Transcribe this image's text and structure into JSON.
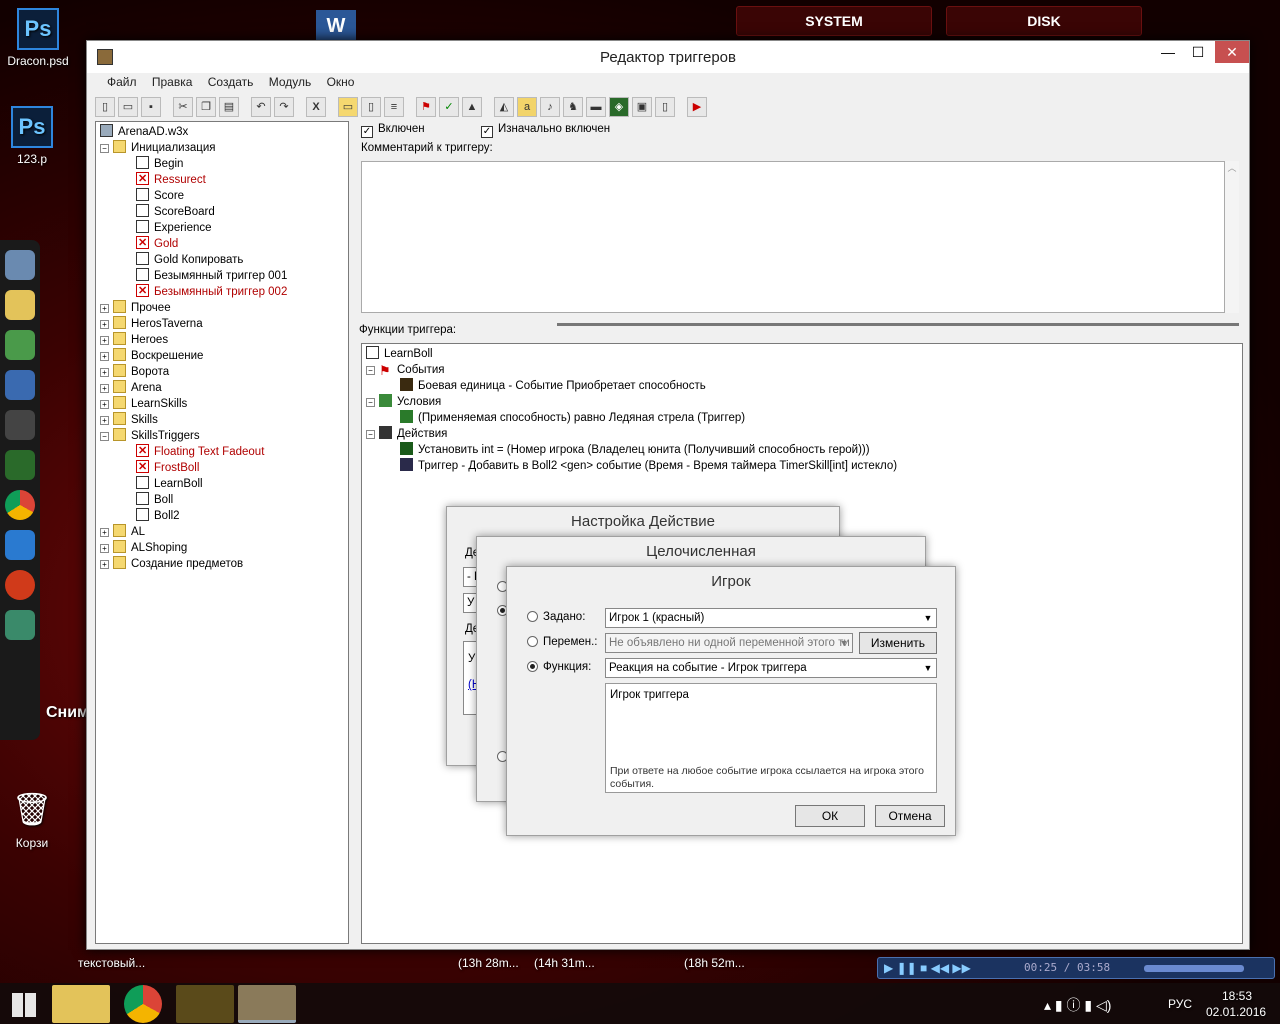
{
  "desktop": {
    "icons": [
      {
        "label": "Dracon.psd",
        "glyph": "Ps"
      },
      {
        "label": "123.p",
        "glyph": "Ps"
      },
      {
        "label": "Корзи",
        "glyph": "🗑"
      }
    ],
    "top_buttons": [
      "SYSTEM",
      "DISK"
    ],
    "screenshot_label": "Снимок экрана",
    "word_icon": "W"
  },
  "window": {
    "title": "Редактор триггеров",
    "controls": {
      "minimize": "—",
      "maximize": "☐",
      "close": "✕"
    },
    "menu": [
      "Файл",
      "Правка",
      "Создать",
      "Модуль",
      "Окно"
    ]
  },
  "tree": {
    "root": "ArenaAD.w3x",
    "nodes": [
      {
        "label": "Инициализация",
        "kind": "folder",
        "expander": "−"
      },
      {
        "label": "Begin",
        "kind": "doc"
      },
      {
        "label": "Ressurect",
        "kind": "disabled"
      },
      {
        "label": "Score",
        "kind": "doc"
      },
      {
        "label": "ScoreBoard",
        "kind": "doc"
      },
      {
        "label": "Experience",
        "kind": "doc"
      },
      {
        "label": "Gold",
        "kind": "disabled"
      },
      {
        "label": "Gold Копировать",
        "kind": "doc"
      },
      {
        "label": "Безымянный триггер 001",
        "kind": "doc"
      },
      {
        "label": "Безымянный триггер 002",
        "kind": "disabled"
      },
      {
        "label": "Прочее",
        "kind": "folder",
        "expander": "+"
      },
      {
        "label": "HerosTaverna",
        "kind": "folder",
        "expander": "+"
      },
      {
        "label": "Heroes",
        "kind": "folder",
        "expander": "+"
      },
      {
        "label": "Воскрешение",
        "kind": "folder",
        "expander": "+"
      },
      {
        "label": "Ворота",
        "kind": "folder",
        "expander": "+"
      },
      {
        "label": "Arena",
        "kind": "folder",
        "expander": "+"
      },
      {
        "label": "LearnSkills",
        "kind": "folder",
        "expander": "+"
      },
      {
        "label": "Skills",
        "kind": "folder",
        "expander": "+"
      },
      {
        "label": "SkillsTriggers",
        "kind": "folder",
        "expander": "−"
      },
      {
        "label": "Floating Text Fadeout",
        "kind": "disabled"
      },
      {
        "label": "FrostBoll",
        "kind": "disabled"
      },
      {
        "label": "LearnBoll",
        "kind": "doc"
      },
      {
        "label": "Boll",
        "kind": "doc"
      },
      {
        "label": "Boll2",
        "kind": "doc"
      },
      {
        "label": "AL",
        "kind": "folder",
        "expander": "+"
      },
      {
        "label": "ALShoping",
        "kind": "folder",
        "expander": "+"
      },
      {
        "label": "Создание предметов",
        "kind": "folder",
        "expander": "+"
      }
    ]
  },
  "trigger": {
    "enabled_label": "Включен",
    "enabled": true,
    "initially_enabled_label": "Изначально включен",
    "initially_enabled": true,
    "comment_label": "Комментарий к триггеру:",
    "comment": "",
    "functions_label": "Функции триггера:",
    "name": "LearnBoll",
    "events_label": "События",
    "event": "Боевая единица - Событие Приобретает способность",
    "conditions_label": "Условия",
    "condition": "(Применяемая способность) равно Ледяная стрела (Триггер)",
    "actions_label": "Действия",
    "actions": [
      "Установить int = (Номер игрока (Владелец юнита (Получивший способность герой)))",
      "Триггер - Добавить в Boll2 <gen> событие (Время - Время таймера TimerSkill[int] истекло)"
    ]
  },
  "dialogs": {
    "back1_title": "Настройка Действие",
    "back1_fragments": [
      "Де",
      "- Е",
      "У",
      "Де",
      "У",
      "(Н"
    ],
    "back2_title": "Целочисленная",
    "front": {
      "title": "Игрок",
      "preset_label": "Задано:",
      "preset_value": "Игрок 1 (красный)",
      "variable_label": "Перемен.:",
      "variable_value": "Не объявлено ни одной переменной этого ти",
      "edit_button": "Изменить",
      "function_label": "Функция:",
      "function_value": "Реакция на событие - Игрок триггера",
      "selected": "function",
      "desc_title": "Игрок триггера",
      "desc_text": "При ответе на любое событие игрока ссылается на игрока этого события.",
      "ok": "ОК",
      "cancel": "Отмена"
    }
  },
  "taskbar_labels": [
    {
      "text": "текстовый..."
    },
    {
      "text": "(13h 28m..."
    },
    {
      "text": "(14h 31m..."
    },
    {
      "text": "(18h 52m..."
    }
  ],
  "media": {
    "time": "00:25 / 03:58"
  },
  "tray": {
    "lang": "РУС",
    "time": "18:53",
    "date": "02.01.2016"
  },
  "colors": {
    "accent_red": "#b00000",
    "titlebar": "#ffffff"
  }
}
